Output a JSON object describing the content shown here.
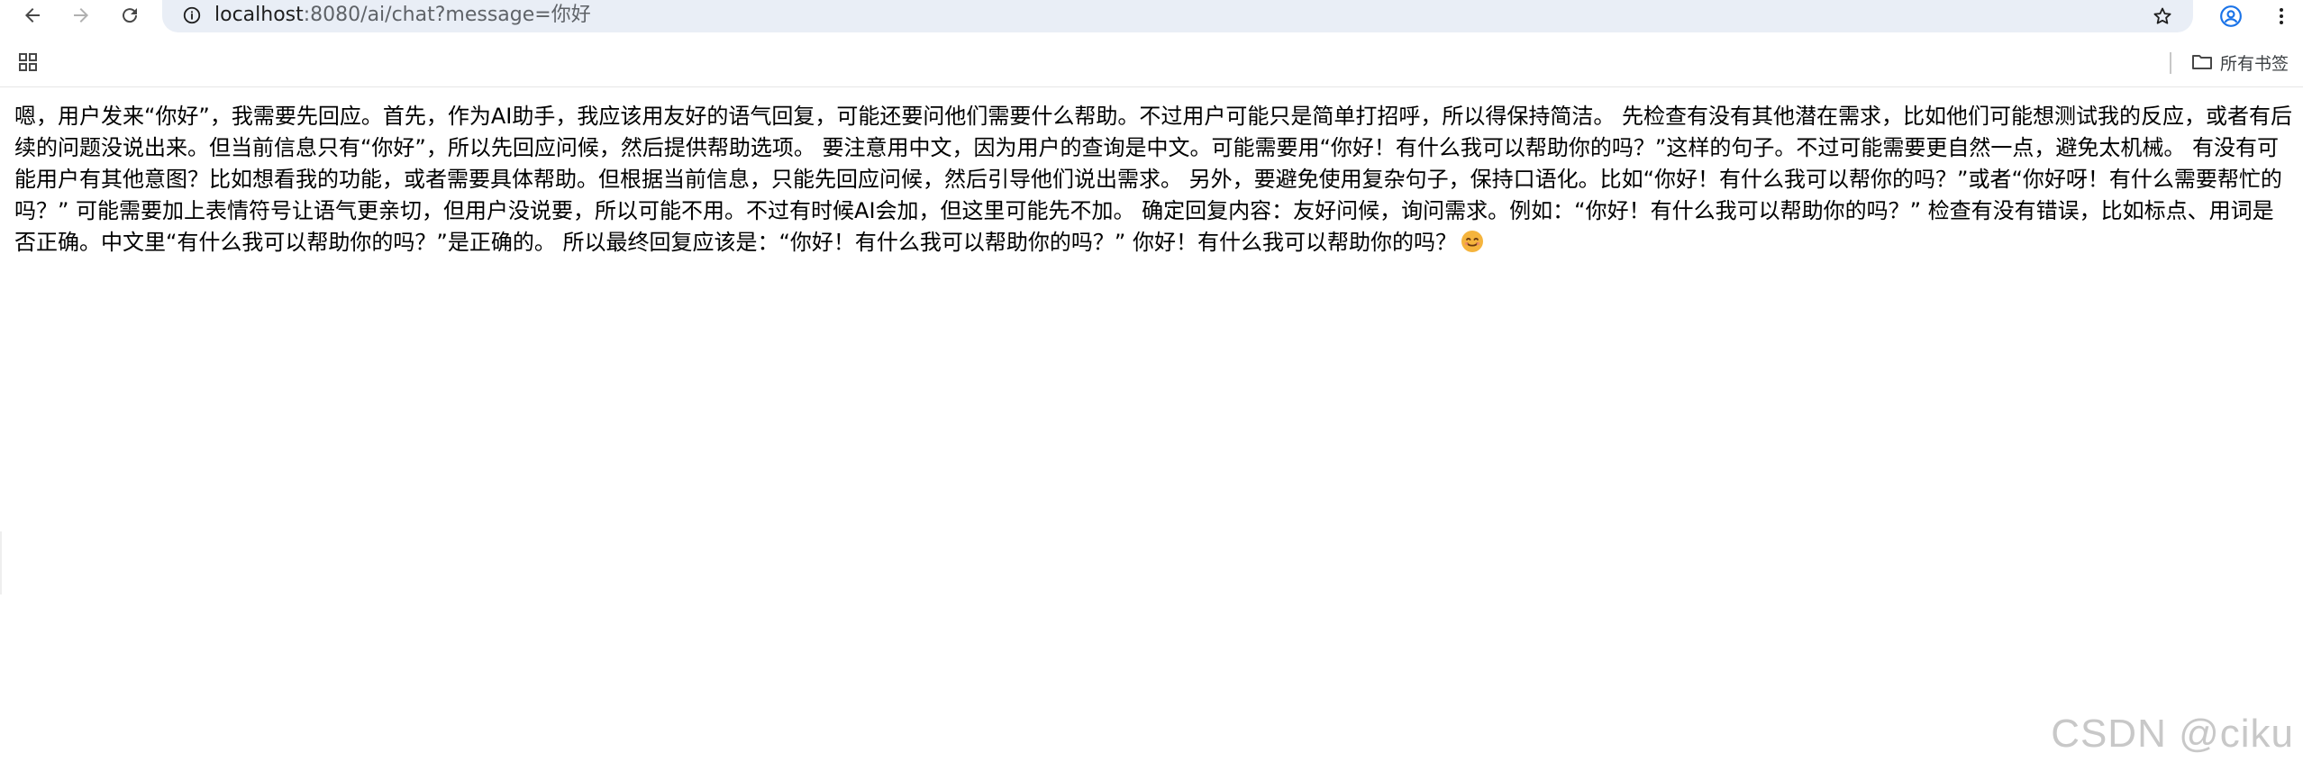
{
  "browser": {
    "url_host": "localhost",
    "url_rest": ":8080/ai/chat?message=你好",
    "icons": {
      "back": "arrow-left-icon",
      "forward": "arrow-right-icon",
      "reload": "reload-icon",
      "site_info": "info-icon",
      "bookmark_star": "star-icon",
      "profile": "profile-icon",
      "menu": "kebab-menu-icon",
      "apps": "apps-grid-icon",
      "folder": "folder-icon"
    },
    "colors": {
      "omnibox_bg": "#e9eef6",
      "profile_accent": "#1a73e8"
    }
  },
  "bookmarks_bar": {
    "all_bookmarks_label": "所有书签"
  },
  "page": {
    "body_text": "嗯，用户发来“你好”，我需要先回应。首先，作为AI助手，我应该用友好的语气回复，可能还要问他们需要什么帮助。不过用户可能只是简单打招呼，所以得保持简洁。 先检查有没有其他潜在需求，比如他们可能想测试我的反应，或者有后续的问题没说出来。但当前信息只有“你好”，所以先回应问候，然后提供帮助选项。 要注意用中文，因为用户的查询是中文。可能需要用“你好！有什么我可以帮助你的吗？”这样的句子。不过可能需要更自然一点，避免太机械。 有没有可能用户有其他意图？比如想看我的功能，或者需要具体帮助。但根据当前信息，只能先回应问候，然后引导他们说出需求。 另外，要避免使用复杂句子，保持口语化。比如“你好！有什么我可以帮你的吗？”或者“你好呀！有什么需要帮忙的吗？” 可能需要加上表情符号让语气更亲切，但用户没说要，所以可能不用。不过有时候AI会加，但这里可能先不加。 确定回复内容：友好问候，询问需求。例如：“你好！有什么我可以帮助你的吗？” 检查有没有错误，比如标点、用词是否正确。中文里“有什么我可以帮助你的吗？”是正确的。 所以最终回复应该是：“你好！有什么我可以帮助你的吗？” 你好！有什么我可以帮助你的吗？",
    "emoji": "smiling-face-emoji"
  },
  "watermark": "CSDN @ciku"
}
